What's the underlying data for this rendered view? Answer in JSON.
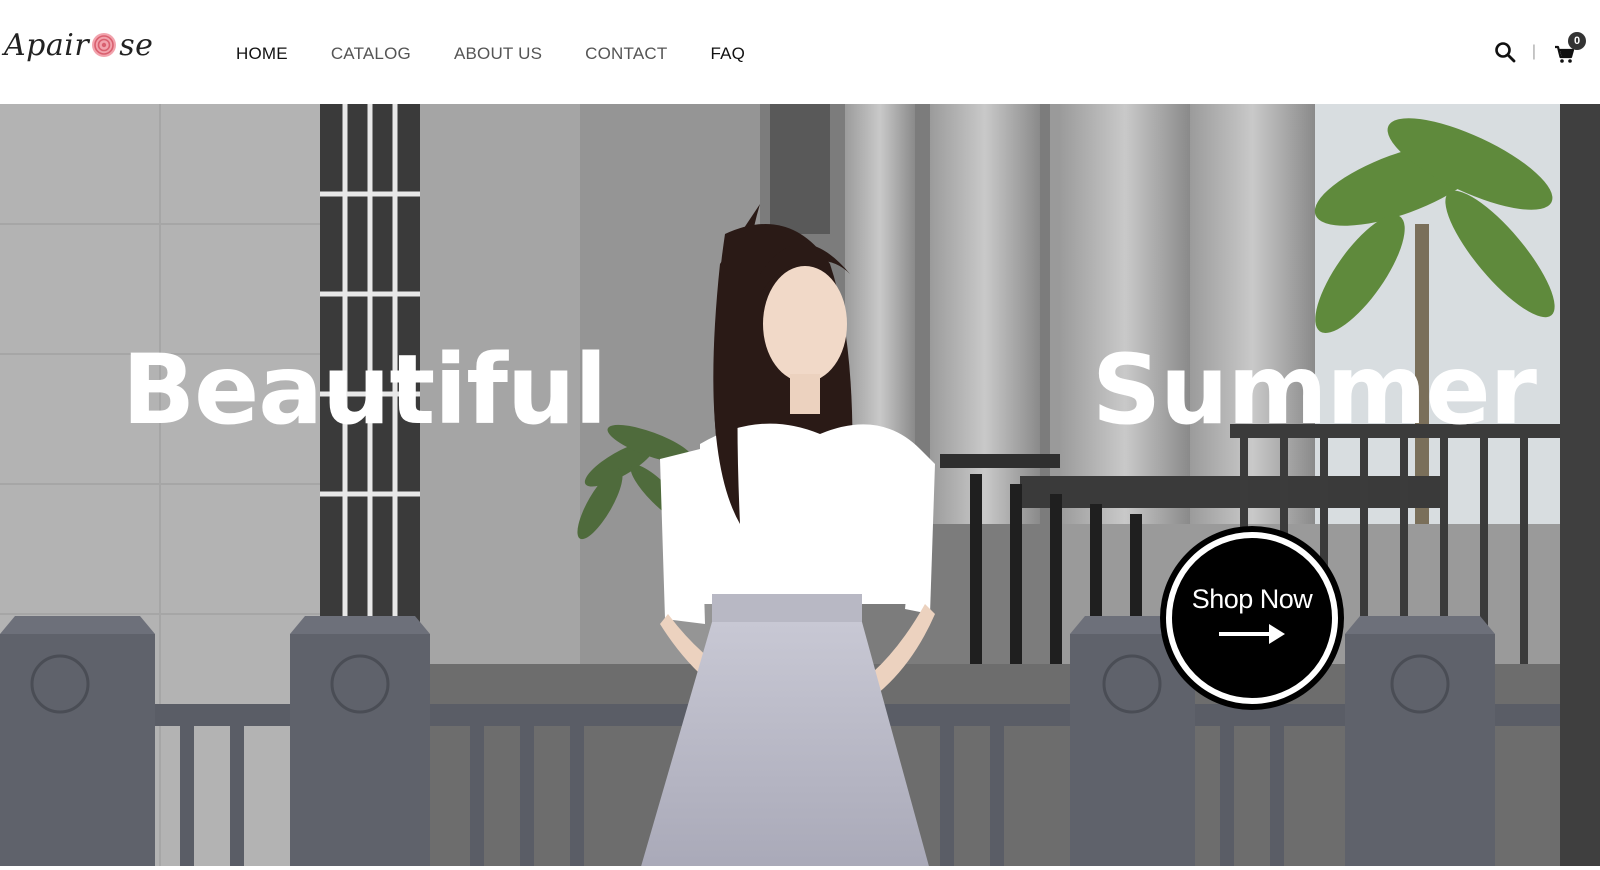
{
  "brand": {
    "logo_text_left": "Apair",
    "logo_text_right": "se"
  },
  "nav": {
    "items": [
      {
        "label": "HOME"
      },
      {
        "label": "CATALOG"
      },
      {
        "label": "ABOUT US"
      },
      {
        "label": "CONTACT"
      },
      {
        "label": "FAQ"
      }
    ]
  },
  "tools": {
    "search_icon": "search-icon",
    "separator": "|",
    "cart_icon": "cart-icon",
    "cart_count": "0"
  },
  "hero": {
    "word_left": "Beautiful",
    "word_right": "Summer",
    "cta_label": "Shop Now",
    "cta_icon": "arrow-right-icon"
  },
  "colors": {
    "text_dark": "#111111",
    "text_nav": "#555555",
    "cta_bg": "#000000",
    "rose": "#e8838f"
  }
}
